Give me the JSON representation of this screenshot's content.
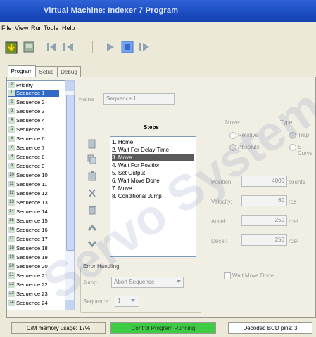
{
  "window": {
    "title": "Virtual Machine: Indexer 7 Program"
  },
  "menu": [
    "File",
    "View",
    "Run",
    "Tools",
    "Help"
  ],
  "tabs": [
    "Program",
    "Setup",
    "Debug"
  ],
  "sequences": [
    {
      "num": "P",
      "label": "Priority"
    },
    {
      "num": "1",
      "label": "Sequence 1"
    },
    {
      "num": "2",
      "label": "Sequence 2"
    },
    {
      "num": "3",
      "label": "Sequence 3"
    },
    {
      "num": "4",
      "label": "Sequence 4"
    },
    {
      "num": "5",
      "label": "Sequence 5"
    },
    {
      "num": "6",
      "label": "Sequence 6"
    },
    {
      "num": "7",
      "label": "Sequence 7"
    },
    {
      "num": "8",
      "label": "Sequence 8"
    },
    {
      "num": "9",
      "label": "Sequence 9"
    },
    {
      "num": "10",
      "label": "Sequence 10"
    },
    {
      "num": "11",
      "label": "Sequence 11"
    },
    {
      "num": "12",
      "label": "Sequence 12"
    },
    {
      "num": "13",
      "label": "Sequence 13"
    },
    {
      "num": "14",
      "label": "Sequence 14"
    },
    {
      "num": "15",
      "label": "Sequence 15"
    },
    {
      "num": "16",
      "label": "Sequence 16"
    },
    {
      "num": "17",
      "label": "Sequence 17"
    },
    {
      "num": "18",
      "label": "Sequence 18"
    },
    {
      "num": "19",
      "label": "Sequence 19"
    },
    {
      "num": "20",
      "label": "Sequence 20"
    },
    {
      "num": "21",
      "label": "Sequence 21"
    },
    {
      "num": "22",
      "label": "Sequence 22"
    },
    {
      "num": "23",
      "label": "Sequence 23"
    },
    {
      "num": "24",
      "label": "Sequence 24"
    }
  ],
  "name_field": {
    "label": "Name",
    "value": "Sequence 1"
  },
  "steps": {
    "title": "Steps",
    "items": [
      "1. Home",
      "2. Wait For Delay Time",
      "3. Move",
      "4. Wait For Position",
      "5. Set Output",
      "6. Wait Move Done",
      "7. Move",
      "8. Conditional Jump"
    ],
    "selected_index": 2
  },
  "move_group": {
    "move_label": "Move:",
    "type_label": "Type:",
    "relative": "Relative",
    "absolute": "Absolute",
    "trap": "Trap",
    "scurve": "S-Curve"
  },
  "params": [
    {
      "label": "Position:",
      "value": "4000",
      "unit": "counts"
    },
    {
      "label": "Velocity:",
      "value": "60",
      "unit": "rps"
    },
    {
      "label": "Accel:",
      "value": "250",
      "unit": "rps²"
    },
    {
      "label": "Decel:",
      "value": "250",
      "unit": "rps²"
    }
  ],
  "wait_move_done": "Wait Move Done",
  "error_handling": {
    "title": "Error Handling",
    "jump_label": "Jump:",
    "jump_value": "Abort Sequence",
    "sequence_label": "Sequence:",
    "sequence_value": "1"
  },
  "status": {
    "memory": "C/M memory usage: 17%",
    "running": "Control Program Running",
    "decoded": "Decoded BCD pins: 3"
  },
  "watermark": "Servo Systems, Inc."
}
